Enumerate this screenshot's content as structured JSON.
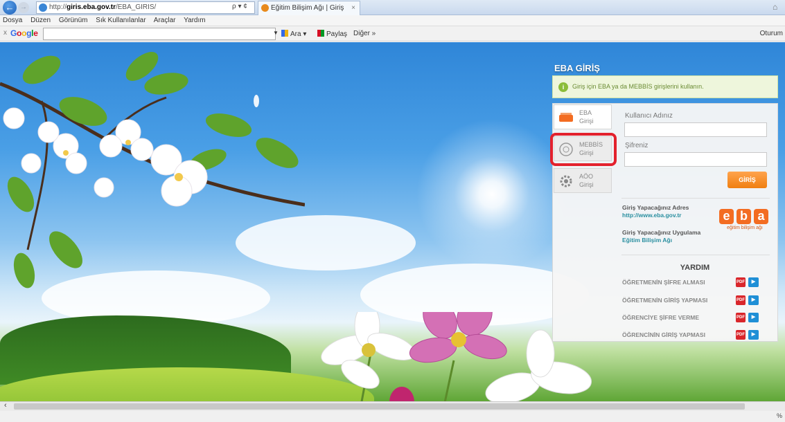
{
  "browser": {
    "address_prefix": "http://",
    "address_host": "giris.eba.gov.tr",
    "address_path": "/EBA_GIRIS/",
    "address_tools": "ρ ▾ ¢",
    "tab_title": "Eğitim Bilişim Ağı | Giriş",
    "tab_close": "×",
    "menu": [
      "Dosya",
      "Düzen",
      "Görünüm",
      "Sık Kullanılanlar",
      "Araçlar",
      "Yardım"
    ],
    "zoom": "%"
  },
  "toolbar": {
    "close": "x",
    "logo": [
      "G",
      "o",
      "o",
      "g",
      "l",
      "e"
    ],
    "search_button": "Ara ▾",
    "share_button": "Paylaş",
    "more_button": "Diğer »",
    "signin": "Oturum"
  },
  "login": {
    "title": "EBA GİRİŞ",
    "notice": "Giriş için EBA ya da MEBBİS girişlerini kullanın.",
    "tabs": [
      {
        "line1": "EBA",
        "line2": "Girişi"
      },
      {
        "line1": "MEBBİS",
        "line2": "Girişi"
      },
      {
        "line1": "AÖO",
        "line2": "Girişi"
      }
    ],
    "username_label": "Kullanıcı Adınız",
    "password_label": "Şifreniz",
    "submit_label": "GİRİŞ",
    "address_label": "Giriş Yapacağınız Adres",
    "address_value": "http://www.eba.gov.tr",
    "app_label": "Giriş Yapacağınız Uygulama",
    "app_value": "Eğitim Bilişim Ağı",
    "logo_letters": [
      "e",
      "b",
      "a"
    ],
    "logo_sub": "eğitim bilişim ağı",
    "help_title": "YARDIM",
    "help_items": [
      "ÖĞRETMENİN ŞİFRE ALMASI",
      "ÖĞRETMENİN GİRİŞ YAPMASI",
      "ÖĞRENCİYE ŞİFRE VERME",
      "ÖĞRENCİNİN GİRİŞ YAPMASI"
    ],
    "pdf_label": "PDF",
    "video_label": "▶"
  },
  "colors": {
    "accent_orange": "#f07f11",
    "highlight_red": "#e3212d",
    "notice_green": "#8bbd3a",
    "link_teal": "#2a8fa0"
  }
}
